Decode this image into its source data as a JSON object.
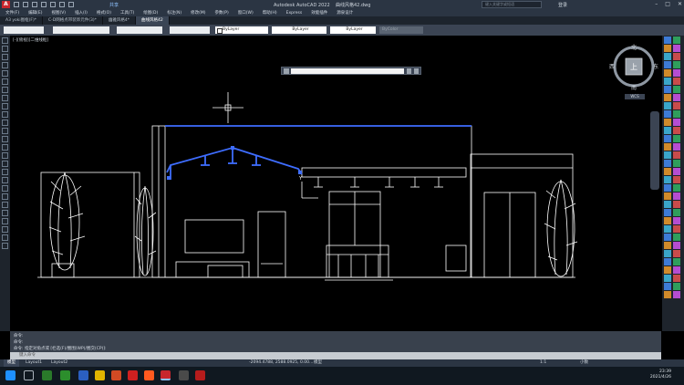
{
  "window": {
    "app_logo": "A",
    "title": "Autodesk AutoCAD 2022",
    "document": "曲线风格42.dwg",
    "share_label": "共享",
    "search_placeholder": "键入关键字或短语",
    "user_label": "登录"
  },
  "menu": [
    "文件(F)",
    "编辑(E)",
    "视图(V)",
    "插入(I)",
    "格式(O)",
    "工具(T)",
    "绘图(D)",
    "标注(N)",
    "修改(M)",
    "参数(P)",
    "窗口(W)",
    "帮助(H)",
    "Express",
    "效能插件",
    "源泉设计"
  ],
  "doc_tabs": [
    {
      "label": "A3 yoki图框(F)*",
      "active": false
    },
    {
      "label": "C-D网格点带装饰元件(3)*",
      "active": false
    },
    {
      "label": "幽雅风格4*",
      "active": false
    },
    {
      "label": "曲线风格42",
      "active": true
    }
  ],
  "properties": {
    "layer": "ByLayer",
    "linetype": "ByLayer",
    "lineweight": "ByLayer",
    "plotstyle": "ByColor"
  },
  "view_label": "[-][俯视][二维线框]",
  "viewcube": {
    "north": "北",
    "south": "南",
    "east": "东",
    "west": "西",
    "top": "上",
    "wcs": "WCS"
  },
  "ucs_y_label": "Y",
  "command_history": [
    "命令:",
    "命令:",
    "命令: 指定对角点或 [栏选(F)/圈围(WP)/圈交(CP)]:"
  ],
  "command_placeholder": "键入命令",
  "layout_tabs": [
    {
      "label": "模型",
      "active": true
    },
    {
      "label": "Layout1",
      "active": false
    },
    {
      "label": "Layout2",
      "active": false
    }
  ],
  "status": {
    "coordinates": "-2094.4788, 2588.0925, 0.00...",
    "mode": "模型",
    "scale": "1:1",
    "units": "小数"
  },
  "taskbar": {
    "time": "23:39",
    "date": "2021/4/26"
  },
  "colors": {
    "background": "#000000",
    "drawing_lines": "#ffffff",
    "highlight": "#3e6dff",
    "ui_dark": "#2b3543"
  }
}
